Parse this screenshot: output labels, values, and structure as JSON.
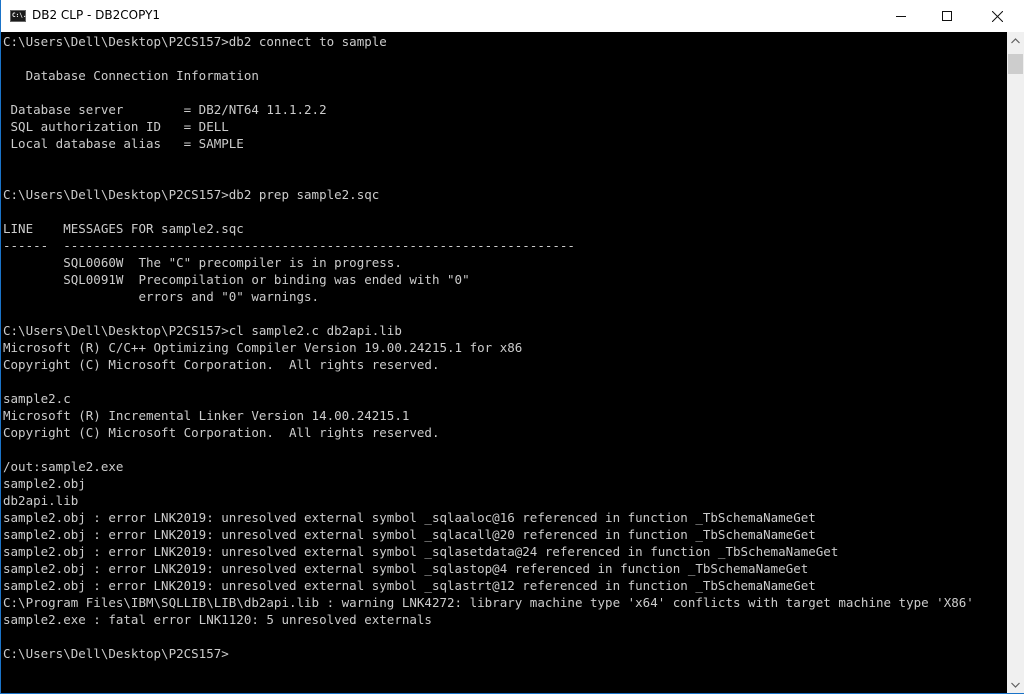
{
  "window": {
    "title": "DB2 CLP - DB2COPY1",
    "app_icon_label": "C:\\.",
    "controls": {
      "minimize": "minimize",
      "maximize": "maximize",
      "close": "close"
    }
  },
  "console": {
    "text_color": "#cccccc",
    "background_color": "#000000",
    "lines": [
      "C:\\Users\\Dell\\Desktop\\P2CS157>db2 connect to sample",
      "",
      "   Database Connection Information",
      "",
      " Database server        = DB2/NT64 11.1.2.2",
      " SQL authorization ID   = DELL",
      " Local database alias   = SAMPLE",
      "",
      "",
      "C:\\Users\\Dell\\Desktop\\P2CS157>db2 prep sample2.sqc",
      "",
      "LINE    MESSAGES FOR sample2.sqc",
      "------  --------------------------------------------------------------------",
      "        SQL0060W  The \"C\" precompiler is in progress.",
      "        SQL0091W  Precompilation or binding was ended with \"0\"",
      "                  errors and \"0\" warnings.",
      "",
      "C:\\Users\\Dell\\Desktop\\P2CS157>cl sample2.c db2api.lib",
      "Microsoft (R) C/C++ Optimizing Compiler Version 19.00.24215.1 for x86",
      "Copyright (C) Microsoft Corporation.  All rights reserved.",
      "",
      "sample2.c",
      "Microsoft (R) Incremental Linker Version 14.00.24215.1",
      "Copyright (C) Microsoft Corporation.  All rights reserved.",
      "",
      "/out:sample2.exe",
      "sample2.obj",
      "db2api.lib",
      "sample2.obj : error LNK2019: unresolved external symbol _sqlaaloc@16 referenced in function _TbSchemaNameGet",
      "sample2.obj : error LNK2019: unresolved external symbol _sqlacall@20 referenced in function _TbSchemaNameGet",
      "sample2.obj : error LNK2019: unresolved external symbol _sqlasetdata@24 referenced in function _TbSchemaNameGet",
      "sample2.obj : error LNK2019: unresolved external symbol _sqlastop@4 referenced in function _TbSchemaNameGet",
      "sample2.obj : error LNK2019: unresolved external symbol _sqlastrt@12 referenced in function _TbSchemaNameGet",
      "C:\\Program Files\\IBM\\SQLLIB\\LIB\\db2api.lib : warning LNK4272: library machine type 'x64' conflicts with target machine type 'X86'",
      "sample2.exe : fatal error LNK1120: 5 unresolved externals",
      "",
      "C:\\Users\\Dell\\Desktop\\P2CS157>"
    ]
  },
  "scrollbar": {
    "up_icon": "chevron-up",
    "down_icon": "chevron-down"
  }
}
